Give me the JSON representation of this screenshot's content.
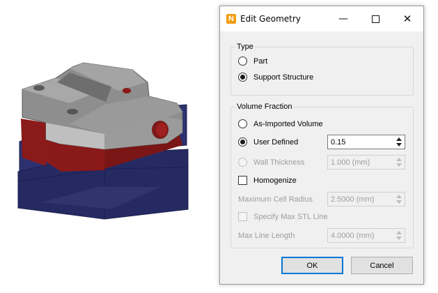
{
  "dialog": {
    "title": "Edit Geometry",
    "app_icon_letter": "N",
    "window_buttons": {
      "minimize": "—",
      "maximize": "box",
      "close": "✕"
    }
  },
  "type_group": {
    "legend": "Type",
    "options": [
      {
        "label": "Part",
        "selected": false
      },
      {
        "label": "Support Structure",
        "selected": true
      }
    ]
  },
  "volume_group": {
    "legend": "Volume Fraction",
    "options": [
      {
        "label": "As-Imported Volume",
        "selected": false,
        "enabled": true
      },
      {
        "label": "User Defined",
        "selected": true,
        "enabled": true,
        "value": "0.15"
      },
      {
        "label": "Wall Thickness",
        "selected": false,
        "enabled": false,
        "value": "1.000 (mm)"
      }
    ],
    "homogenize": {
      "label": "Homogenize",
      "checked": false
    },
    "max_cell_radius": {
      "label": "Maximum Cell Radius",
      "value": "2.5000 (mm)",
      "enabled": false
    },
    "specify_max_stl": {
      "label": "Specify Max STL Line",
      "checked": false,
      "enabled": false
    },
    "max_line_length": {
      "label": "Max Line Length",
      "value": "4.0000 (mm)",
      "enabled": false
    }
  },
  "buttons": {
    "ok": "OK",
    "cancel": "Cancel"
  },
  "colors": {
    "part_gray": "#8c8c8c",
    "part_red": "#8b1a1a",
    "support_navy": "#2b2f6b",
    "accent_orange": "#f39c12",
    "focus_blue": "#0078d7"
  }
}
